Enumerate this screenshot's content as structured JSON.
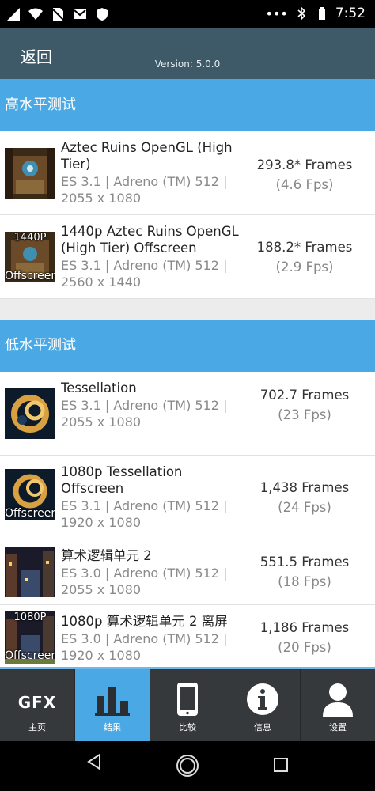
{
  "status_bar": {
    "time": "7:52"
  },
  "header": {
    "back_label": "返回",
    "version": "Version: 5.0.0"
  },
  "sections": [
    {
      "title": "高水平测试",
      "items": [
        {
          "title": "Aztec Ruins OpenGL (High Tier)",
          "sub": "ES 3.1 | Adreno (TM) 512 | 2055 x 1080",
          "frames": "293.8* Frames",
          "fps": "(4.6 Fps)",
          "thumb": "aztec-ruins-icon",
          "thumb_text_top": "",
          "thumb_text_bottom": ""
        },
        {
          "title": "1440p Aztec Ruins OpenGL (High Tier) Offscreen",
          "sub": "ES 3.1 | Adreno (TM) 512 | 2560 x 1440",
          "frames": "188.2* Frames",
          "fps": "(2.9 Fps)",
          "thumb": "aztec-ruins-icon",
          "thumb_text_top": "1440P",
          "thumb_text_bottom": "Offscreen"
        }
      ]
    },
    {
      "title": "低水平测试",
      "items": [
        {
          "title": "Tessellation",
          "sub": "ES 3.1 | Adreno (TM) 512 | 2055 x 1080",
          "frames": "702.7 Frames",
          "fps": "(23 Fps)",
          "thumb": "tessellation-icon",
          "thumb_text_top": "",
          "thumb_text_bottom": ""
        },
        {
          "title": "1080p Tessellation Offscreen",
          "sub": "ES 3.1 | Adreno (TM) 512 | 1920 x 1080",
          "frames": "1,438 Frames",
          "fps": "(24 Fps)",
          "thumb": "tessellation-icon",
          "thumb_text_top": "",
          "thumb_text_bottom": "Offscreen"
        },
        {
          "title": "算术逻辑单元 2",
          "sub": "ES 3.0 | Adreno (TM) 512 | 2055 x 1080",
          "frames": "551.5 Frames",
          "fps": "(18 Fps)",
          "thumb": "alu-city-icon",
          "thumb_text_top": "",
          "thumb_text_bottom": ""
        },
        {
          "title": "1080p 算术逻辑单元 2 离屏",
          "sub": "ES 3.0 | Adreno (TM) 512 | 1920 x 1080",
          "frames": "1,186 Frames",
          "fps": "(20 Fps)",
          "thumb": "alu-city-icon",
          "thumb_text_top": "1080P",
          "thumb_text_bottom": "Offscreen"
        }
      ]
    }
  ],
  "bottom_nav": [
    {
      "label": "主页",
      "icon": "gfx-logo-icon",
      "logo_text": "GFX",
      "active": false
    },
    {
      "label": "结果",
      "icon": "bar-chart-icon",
      "active": true
    },
    {
      "label": "比较",
      "icon": "phone-icon",
      "active": false
    },
    {
      "label": "信息",
      "icon": "info-icon",
      "active": false
    },
    {
      "label": "设置",
      "icon": "person-icon",
      "active": false
    }
  ],
  "colors": {
    "header_bg": "#3e5a68",
    "section_bg": "#4aa9e4",
    "nav_bg": "#35393c",
    "active_tab": "#4aa9e4"
  }
}
